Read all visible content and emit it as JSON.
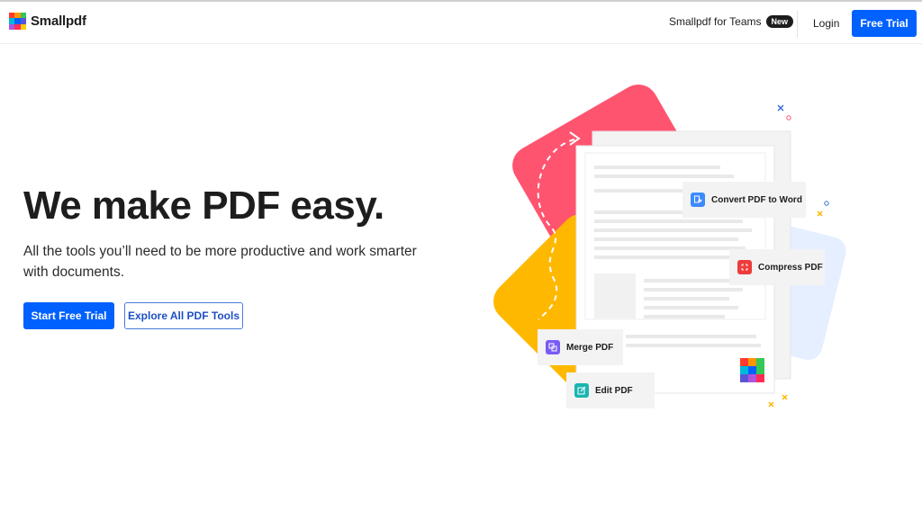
{
  "brand": {
    "name": "Smallpdf",
    "logo_colors": [
      "#ff3b30",
      "#ff9500",
      "#34c759",
      "#00b8d9",
      "#0061fe",
      "#5856d6",
      "#af52de",
      "#ff2d55",
      "#ffcc00"
    ]
  },
  "nav": {
    "teams_label": "Smallpdf for Teams",
    "teams_badge": "New",
    "login_label": "Login",
    "trial_label": "Free Trial"
  },
  "hero": {
    "title": "We make PDF easy.",
    "subtitle": "All the tools you’ll need to be more productive and work smarter with documents.",
    "primary_cta": "Start Free Trial",
    "secondary_cta": "Explore All PDF Tools"
  },
  "tools": {
    "convert": "Convert PDF to Word",
    "compress": "Compress PDF",
    "merge": "Merge PDF",
    "edit": "Edit PDF"
  },
  "colors": {
    "accent": "#0061fe",
    "pink": "#ff5470",
    "yellow": "#ffb800",
    "light_blue": "#e6efff",
    "convert_icon": "#3d8bfd",
    "compress_icon": "#ee3b3b",
    "merge_icon": "#7a5cf5",
    "edit_icon": "#1ab5b0"
  }
}
